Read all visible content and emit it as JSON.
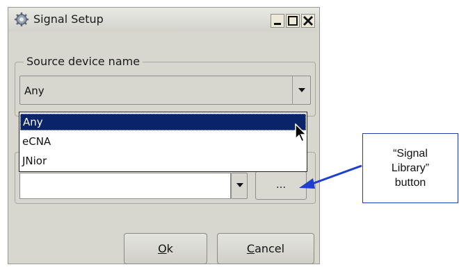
{
  "window": {
    "title": "Signal Setup",
    "controls": [
      "minimize",
      "maximize",
      "close"
    ]
  },
  "source_group": {
    "legend": "Source device name",
    "combo_value": "Any"
  },
  "dropdown": {
    "items": [
      "Any",
      "eCNA",
      "JNior"
    ],
    "selected_index": 0
  },
  "signal_row": {
    "edit_value": "",
    "library_button_label": "..."
  },
  "buttons": {
    "ok": {
      "mnemonic": "O",
      "rest": "k"
    },
    "cancel": {
      "mnemonic": "C",
      "rest": "ancel"
    }
  },
  "callout": {
    "text": "“Signal\nLibrary”\nbutton"
  },
  "colors": {
    "selection": "#0a246a",
    "callout_border": "#1d3fb5",
    "arrow": "#1f3fd0",
    "window_bg": "#d7d7d0"
  },
  "icons": {
    "app": "gear-icon",
    "cursor": "mouse-pointer-icon"
  }
}
